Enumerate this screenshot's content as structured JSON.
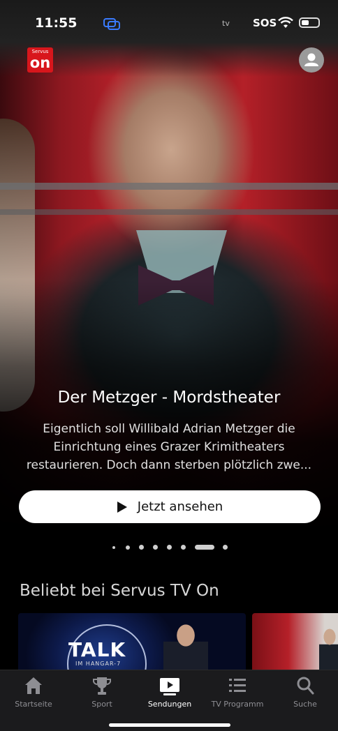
{
  "status_bar": {
    "time": "11:55",
    "network_label": "tv",
    "sos": "SOS"
  },
  "app": {
    "logo_text": "on",
    "logo_small_text": "Servus"
  },
  "hero": {
    "title": "Der Metzger - Mordstheater",
    "description": "Eigentlich soll Willibald Adrian Metzger die Einrichtung eines Grazer Krimitheaters restaurieren. Doch dann sterben plötzlich zwe...",
    "watch_button": "Jetzt ansehen",
    "carousel": {
      "total": 8,
      "active_index": 6
    }
  },
  "section": {
    "title": "Beliebt bei Servus TV On",
    "cards": [
      {
        "title": "TALK",
        "subtitle": "IM HANGAR-7"
      }
    ]
  },
  "tabs": [
    {
      "label": "Startseite",
      "icon": "home-icon",
      "active": false
    },
    {
      "label": "Sport",
      "icon": "trophy-icon",
      "active": false
    },
    {
      "label": "Sendungen",
      "icon": "play-screen-icon",
      "active": true
    },
    {
      "label": "TV Programm",
      "icon": "list-icon",
      "active": false
    },
    {
      "label": "Suche",
      "icon": "search-icon",
      "active": false
    }
  ],
  "colors": {
    "brand_red": "#d8161c",
    "tab_inactive": "#8e8e93",
    "link_indicator": "#3a7bff"
  }
}
